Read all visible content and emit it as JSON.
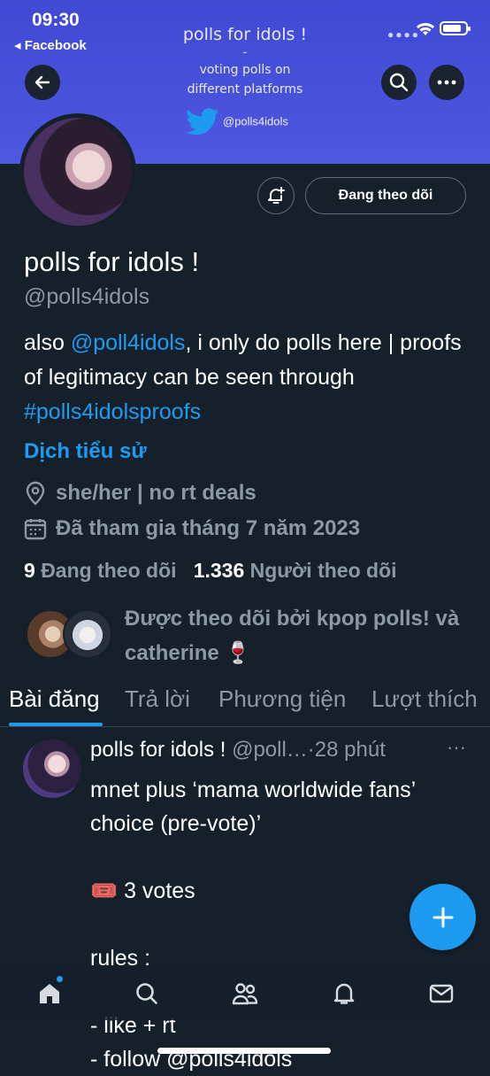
{
  "status_bar": {
    "time": "09:30",
    "back_app": "◂ Facebook"
  },
  "banner": {
    "title": "polls for idols !",
    "dash": "-",
    "subtitle": "voting polls on\ndifferent platforms",
    "twitter_handle": "@polls4idols"
  },
  "profile": {
    "follow_button": "Đang theo dõi",
    "name": "polls for idols !",
    "handle": "@polls4idols",
    "bio_1": "also ",
    "bio_mention": "@poll4idols",
    "bio_2": ", i only do polls here | proofs of legitimacy can be seen through ",
    "bio_hashtag": "#polls4idolsproofs",
    "translate": "Dịch tiểu sử",
    "location": "she/her | no rt deals",
    "joined": "Đã tham gia tháng 7 năm 2023",
    "following_count": "9",
    "following_label": "Đang theo dõi",
    "followers_count": "1.336",
    "followers_label": "Người theo dõi",
    "followed_by": "Được theo dõi bởi kpop polls! và catherine 🍷"
  },
  "tabs": [
    "Bài đăng",
    "Trả lời",
    "Phương tiện",
    "Lượt thích"
  ],
  "post": {
    "name": "polls for idols !",
    "handle_time": " @poll…·28 phút",
    "more": "···",
    "body": "mnet plus ‘mama worldwide fans’ choice (pre-vote)’\n\n🎟️ 3 votes\n\nrules :\n\n- like + rt\n- follow @polls4idols"
  },
  "colors": {
    "accent": "#1d9bf0",
    "background": "#15202b",
    "banner": "#4a52dc",
    "muted": "#8b98a5"
  },
  "icons": [
    "arrow-left-icon",
    "search-icon",
    "more-icon",
    "bell-plus-icon",
    "location-icon",
    "calendar-icon",
    "plus-icon",
    "home-icon",
    "search-nav-icon",
    "communities-icon",
    "notifications-icon",
    "messages-icon"
  ]
}
